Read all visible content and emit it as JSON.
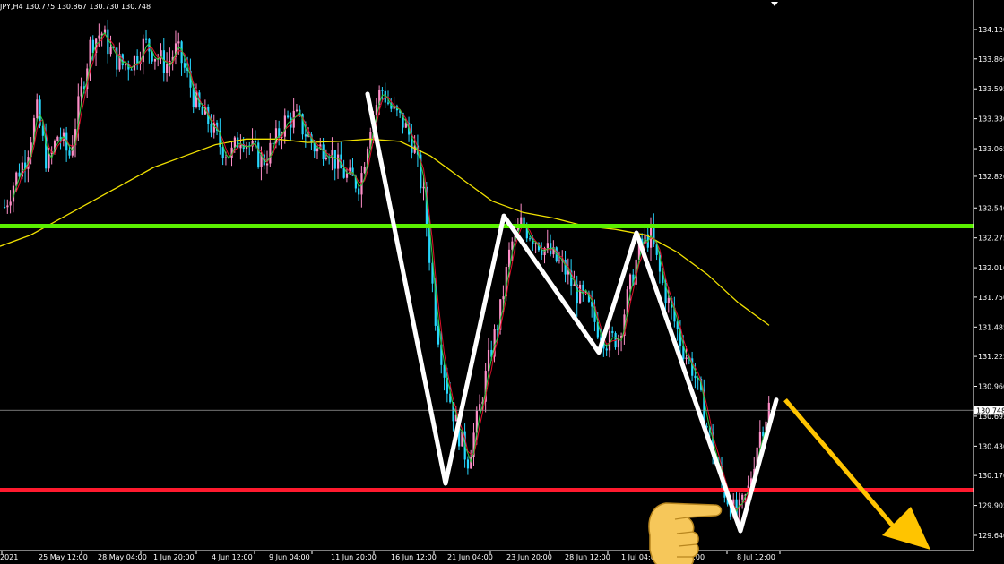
{
  "header": {
    "symbol": "JPY,H4",
    "open": "130.775",
    "high": "130.867",
    "low": "130.730",
    "close": "130.748"
  },
  "colors": {
    "background": "#000000",
    "bull_candle": "#ff8fc8",
    "bear_candle": "#26d7ff",
    "ma_slow": "#f0e000",
    "ma_fast": "#2ecc40",
    "ma_fast2": "#e0102a",
    "resistance": "#5bf000",
    "support": "#ff1a2e",
    "pattern": "#ffffff",
    "forecast_arrow": "#ffc400",
    "axis": "#ffffff"
  },
  "chart_data": {
    "type": "candlestick",
    "instrument": "USDJPY",
    "timeframe": "H4",
    "ylim": [
      129.5,
      134.25
    ],
    "y_ticks": [
      "134.120",
      "133.860",
      "133.595",
      "133.330",
      "133.065",
      "132.820",
      "132.540",
      "132.275",
      "132.010",
      "131.750",
      "131.485",
      "131.225",
      "130.960",
      "130.695",
      "130.430",
      "130.170",
      "129.905",
      "129.640"
    ],
    "x_ticks": [
      "2021",
      "25 May 12:00",
      "28 May 04:00",
      "1 Jun 20:00",
      "4 Jun 12:00",
      "9 Jun 04:00",
      "11 Jun 20:00",
      "16 Jun 12:00",
      "21 Jun 04:00",
      "23 Jun 20:00",
      "28 Jun 12:00",
      "1 Jul 04:00",
      "20:00",
      "8 Jul 12:00"
    ],
    "current_price": "130.748",
    "horizontal_lines": [
      {
        "name": "resistance",
        "price": 132.38
      },
      {
        "name": "support",
        "price": 130.04
      }
    ],
    "pattern_points": [
      {
        "t": 0.0,
        "price": 133.55
      },
      {
        "t": 0.0,
        "price": 130.1
      },
      {
        "t": 0.0,
        "price": 132.47
      },
      {
        "t": 0.0,
        "price": 131.26
      },
      {
        "t": 0.0,
        "price": 132.32
      },
      {
        "t": 0.0,
        "price": 129.68
      },
      {
        "t": 0.0,
        "price": 130.84
      }
    ],
    "forecast": {
      "from_price": 130.84,
      "to_price": 129.55
    },
    "candles_close_path": [
      132.55,
      132.8,
      133.0,
      133.4,
      132.9,
      133.2,
      133.0,
      133.5,
      134.0,
      134.1,
      133.9,
      133.8,
      133.85,
      134.0,
      133.9,
      133.8,
      133.95,
      133.7,
      133.4,
      133.3,
      133.1,
      133.0,
      133.2,
      133.05,
      132.95,
      133.1,
      133.3,
      133.35,
      133.2,
      133.05,
      133.1,
      132.9,
      132.8,
      132.75,
      133.3,
      133.6,
      133.4,
      133.3,
      133.1,
      132.6,
      131.6,
      131.0,
      130.6,
      130.3,
      130.7,
      131.2,
      131.6,
      132.2,
      132.4,
      132.3,
      132.2,
      132.1,
      132.0,
      131.8,
      131.7,
      131.5,
      131.35,
      131.4,
      131.8,
      132.2,
      132.3,
      131.9,
      131.6,
      131.3,
      131.1,
      130.7,
      130.3,
      130.0,
      129.8,
      130.0,
      130.5,
      130.78
    ],
    "ma_slow_values": [
      132.2,
      132.3,
      132.45,
      132.6,
      132.75,
      132.9,
      133.0,
      133.1,
      133.15,
      133.15,
      133.12,
      133.13,
      133.15,
      133.13,
      133.0,
      132.8,
      132.6,
      132.5,
      132.45,
      132.38,
      132.35,
      132.3,
      132.15,
      131.95,
      131.7,
      131.5
    ]
  },
  "overlay": {
    "hand_icon": "pointing-hand-icon"
  }
}
